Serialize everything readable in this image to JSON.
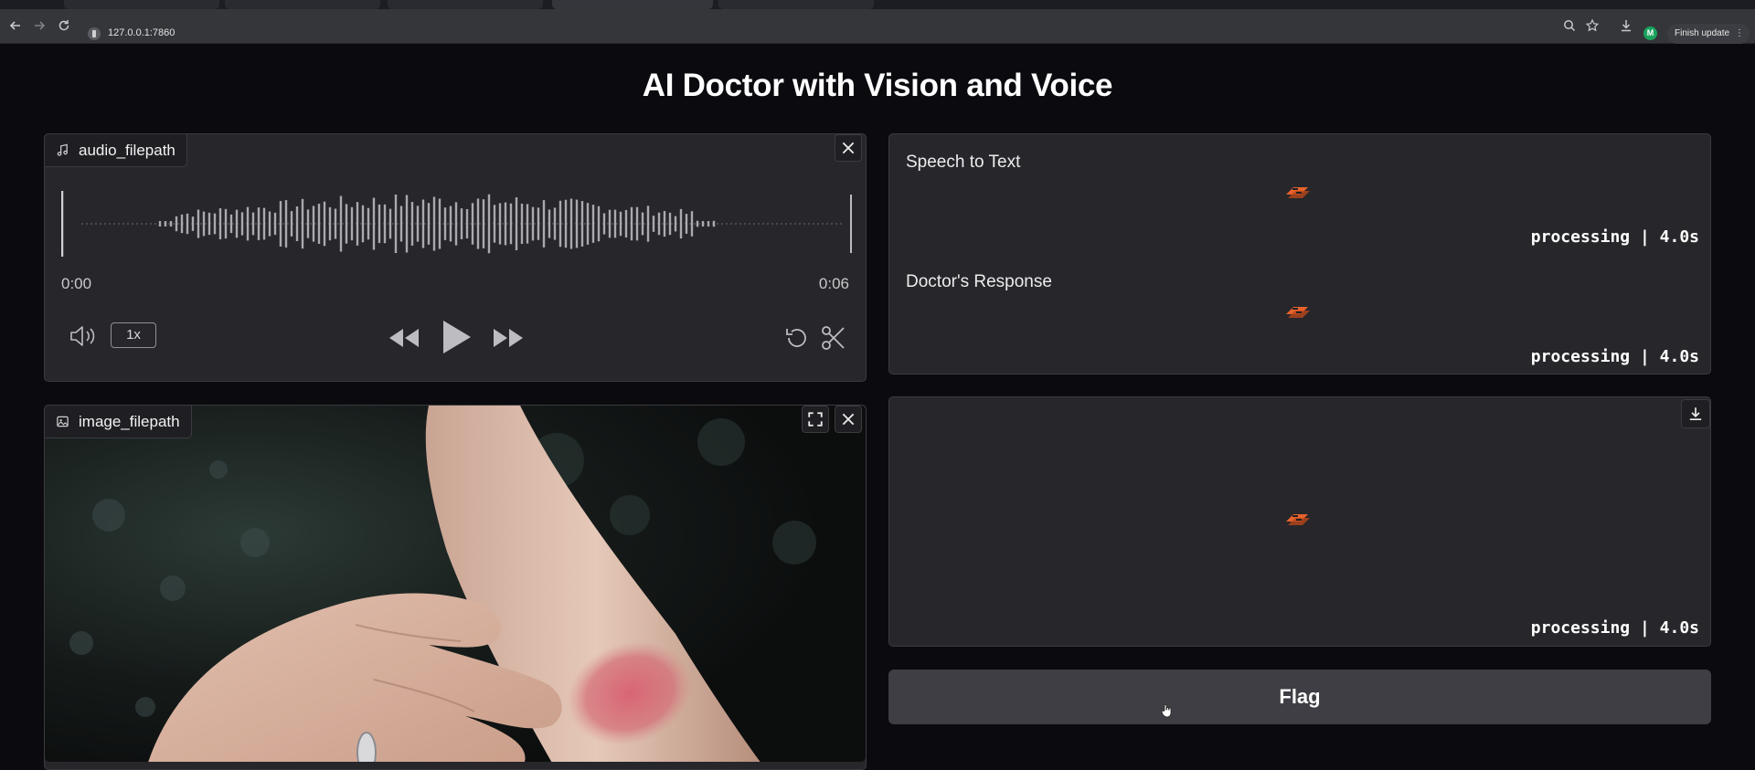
{
  "browser": {
    "url": "127.0.0.1:7860",
    "profile_initial": "M",
    "finish_update_label": "Finish update"
  },
  "page": {
    "title": "AI Doctor with Vision and Voice"
  },
  "audio_input": {
    "label": "audio_filepath",
    "current_time": "0:00",
    "duration": "0:06",
    "playback_speed": "1x"
  },
  "image_input": {
    "label": "image_filepath"
  },
  "outputs": {
    "speech_to_text": {
      "label": "Speech to Text",
      "status": "processing | 4.0s"
    },
    "doctors_response": {
      "label": "Doctor's Response",
      "status": "processing | 4.0s"
    },
    "audio_output": {
      "status": "processing | 4.0s"
    }
  },
  "flag_button": {
    "label": "Flag"
  },
  "colors": {
    "background": "#0b0b0f",
    "panel": "#27272b",
    "spinner_accent": "#e8622c",
    "flag_button": "#3e3e44"
  }
}
